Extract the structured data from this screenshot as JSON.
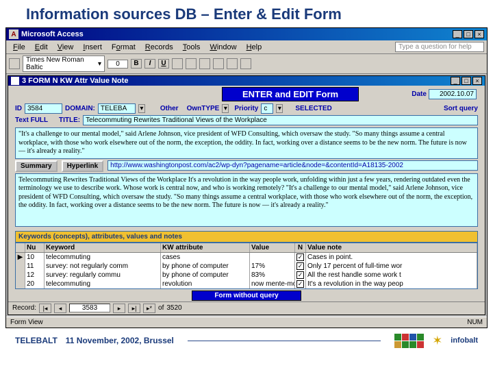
{
  "slide": {
    "title": "Information sources DB – Enter & Edit Form"
  },
  "app": {
    "title": "Microsoft Access",
    "menu": [
      "File",
      "Edit",
      "View",
      "Insert",
      "Format",
      "Records",
      "Tools",
      "Window",
      "Help"
    ],
    "help_placeholder": "Type a question for help",
    "font_name": "Times New Roman Baltic",
    "font_size": "0",
    "fmt": {
      "b": "B",
      "i": "I",
      "u": "U"
    }
  },
  "subform": {
    "title": "3 FORM N KW Attr Value Note"
  },
  "form": {
    "header": "ENTER and EDIT Form",
    "date_lbl": "Date",
    "date_val": "2002.10.07",
    "id_lbl": "ID",
    "id_val": "3584",
    "domain_lbl": "DOMAIN:",
    "domain_val": "TELEBA",
    "other_lbl": "Other",
    "owntype_lbl": "OwnTYPE",
    "priority_lbl": "Priority",
    "priority_val": "c",
    "selected_lbl": "SELECTED",
    "sortquery_lbl": "Sort query",
    "title_lbl": "TITLE:",
    "title_val": "Telecommuting Rewrites Traditional Views of the Workplace",
    "textfull_lbl": "Text FULL",
    "textfull_val": "\"It's a challenge to our mental model,\" said Arlene Johnson, vice president of WFD Consulting, which oversaw the study. \"So many things assume a central workplace, with those who work elsewhere out of the norm, the exception, the oddity. In fact, working over a distance seems to be the new norm. The future is now — it's already a reality.\"",
    "summary_btn": "Summary",
    "hyperlink_btn": "Hyperlink",
    "hyperlink_val": "http://www.washingtonpost.com/ac2/wp-dyn?pagename=article&node=&contentId=A18135-2002",
    "bigtext_val": "Telecommuting Rewrites Traditional Views of the Workplace\nIt's a revolution in the way people work, unfolding within just a few years, rendering outdated even the terminology we use to describe work. Whose work is central now, and who is working remotely?\n\"It's a challenge to our mental model,\" said Arlene Johnson, vice president of WFD Consulting, which oversaw the study. \"So many things assume a central workplace, with those who work elsewhere out of the norm, the exception, the oddity. In fact, working over a distance seems to be the new norm. The future is now — it's already a reality.\"",
    "kw_header": "Keywords (concepts), attributes, values and notes",
    "table": {
      "cols": [
        "Nu",
        "Keyword",
        "KW attribute",
        "Value",
        "N",
        "Value note"
      ],
      "rows": [
        {
          "sel": "▶",
          "num": "10",
          "kw": "telecommuting",
          "attr": "cases",
          "val": "",
          "chk": true,
          "note": "Cases in point."
        },
        {
          "sel": "",
          "num": "11",
          "kw": "survey: not regularly comm",
          "attr": "by phone of computer",
          "val": "17%",
          "chk": true,
          "note": "Only 17 percent of full-time wor"
        },
        {
          "sel": "",
          "num": "12",
          "kw": "survey: regularly commu",
          "attr": "by phone of computer",
          "val": "83%",
          "chk": true,
          "note": "All the rest handle some work t"
        },
        {
          "sel": "",
          "num": "20",
          "kw": "telecommuting",
          "attr": "revolution",
          "val": "now mente-model",
          "chk": true,
          "note": "It's a revolution in the way peop"
        }
      ]
    },
    "form_without_query": "Form without query"
  },
  "recordnav": {
    "label": "Record:",
    "current": "3583",
    "of_lbl": "of",
    "total": "3520"
  },
  "statusbar": {
    "left": "Form View",
    "right": "NUM"
  },
  "footer": {
    "org": "TELEBALT",
    "date_place": "11 November, 2002, Brussel",
    "logo2": "infobalt"
  }
}
